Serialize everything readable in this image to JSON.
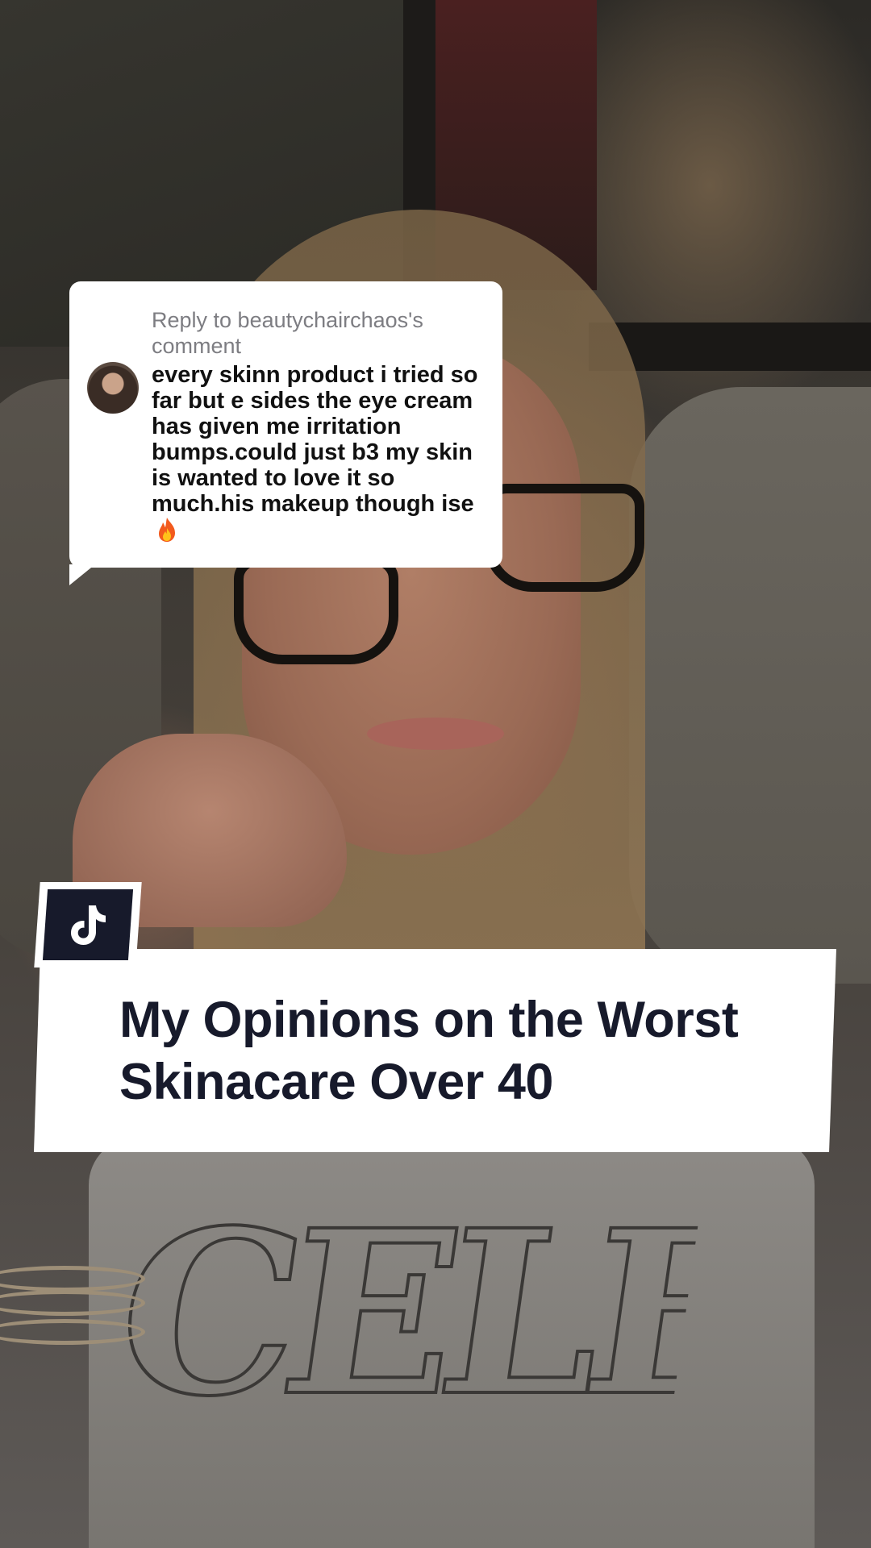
{
  "reply": {
    "header": "Reply to beautychairchaos's comment",
    "comment": "every skinn product i tried so far but e sides the eye cream has given me irritation bumps.could just b3 my skin is wanted to love it so much.his makeup though ise",
    "emoji_icon": "fire-icon"
  },
  "title_card": {
    "badge_icon": "tiktok-logo-icon",
    "title": "My Opinions on the Worst Skinacare Over 40"
  },
  "colors": {
    "title_text": "#171a2b",
    "badge_bg": "#171a2b",
    "card_bg": "#ffffff",
    "reply_header": "#7d7d82"
  }
}
